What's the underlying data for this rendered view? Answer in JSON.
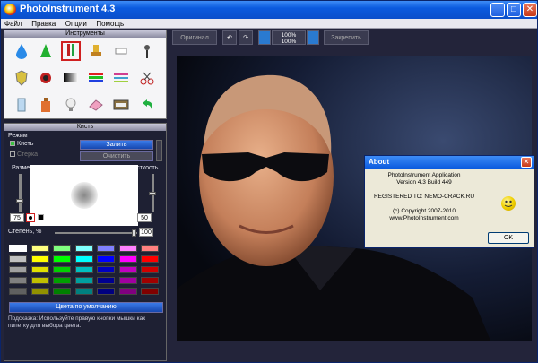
{
  "window": {
    "title": "PhotoInstrument 4.3",
    "min": "_",
    "max": "□",
    "close": "✕"
  },
  "menu": [
    "Файл",
    "Правка",
    "Опции",
    "Помощь"
  ],
  "tools_panel": {
    "title": "Инструменты"
  },
  "brush_panel": {
    "title": "Кисть",
    "mode_label": "Режим",
    "opt_brush": "Кисть",
    "opt_eraser": "Стерка",
    "fill_btn": "Залить",
    "clear_btn": "Очистить",
    "size_label": "Размер",
    "hardness_label": "Жесткость",
    "size_value": "75",
    "hardness_value": "50",
    "degree_label": "Степень, %",
    "degree_value": "100",
    "default_colors_btn": "Цвета по умолчанию",
    "hint": "Подсказка: Используйте правую кнопки мышки как пипетку для выбора цвета."
  },
  "palette_colors": [
    [
      "#ffffff",
      "#ffff80",
      "#80ff80",
      "#80ffff",
      "#8080ff",
      "#ff80ff",
      "#ff8080"
    ],
    [
      "#c0c0c0",
      "#ffff00",
      "#00ff00",
      "#00ffff",
      "#0000ff",
      "#ff00ff",
      "#ff0000"
    ],
    [
      "#a0a0a0",
      "#e0e000",
      "#00d000",
      "#00c0c0",
      "#0000c0",
      "#c000c0",
      "#d00000"
    ],
    [
      "#808080",
      "#c0c000",
      "#00a000",
      "#00a0a0",
      "#000090",
      "#a000a0",
      "#a00000"
    ],
    [
      "#606060",
      "#909000",
      "#008000",
      "#008080",
      "#000080",
      "#800080",
      "#800000"
    ]
  ],
  "toolbar": {
    "original": "Оригинал",
    "undo_icon": "undo-icon",
    "redo_icon": "redo-icon",
    "zoom1": "100%",
    "zoom2": "100%",
    "pin": "Закрепить"
  },
  "about": {
    "title": "About",
    "lines": [
      "PhotoInstrument Application",
      "Version 4.3 Build 449",
      "",
      "REGISTERED TO: NEMO-CRACK.RU",
      "",
      "(c) Copyright 2007-2010",
      "www.PhotoInstrument.com"
    ],
    "ok": "OK"
  },
  "colors": {
    "accent": "#0b5ade",
    "panel": "#1e2033",
    "fill_button": "#2a62d0"
  }
}
